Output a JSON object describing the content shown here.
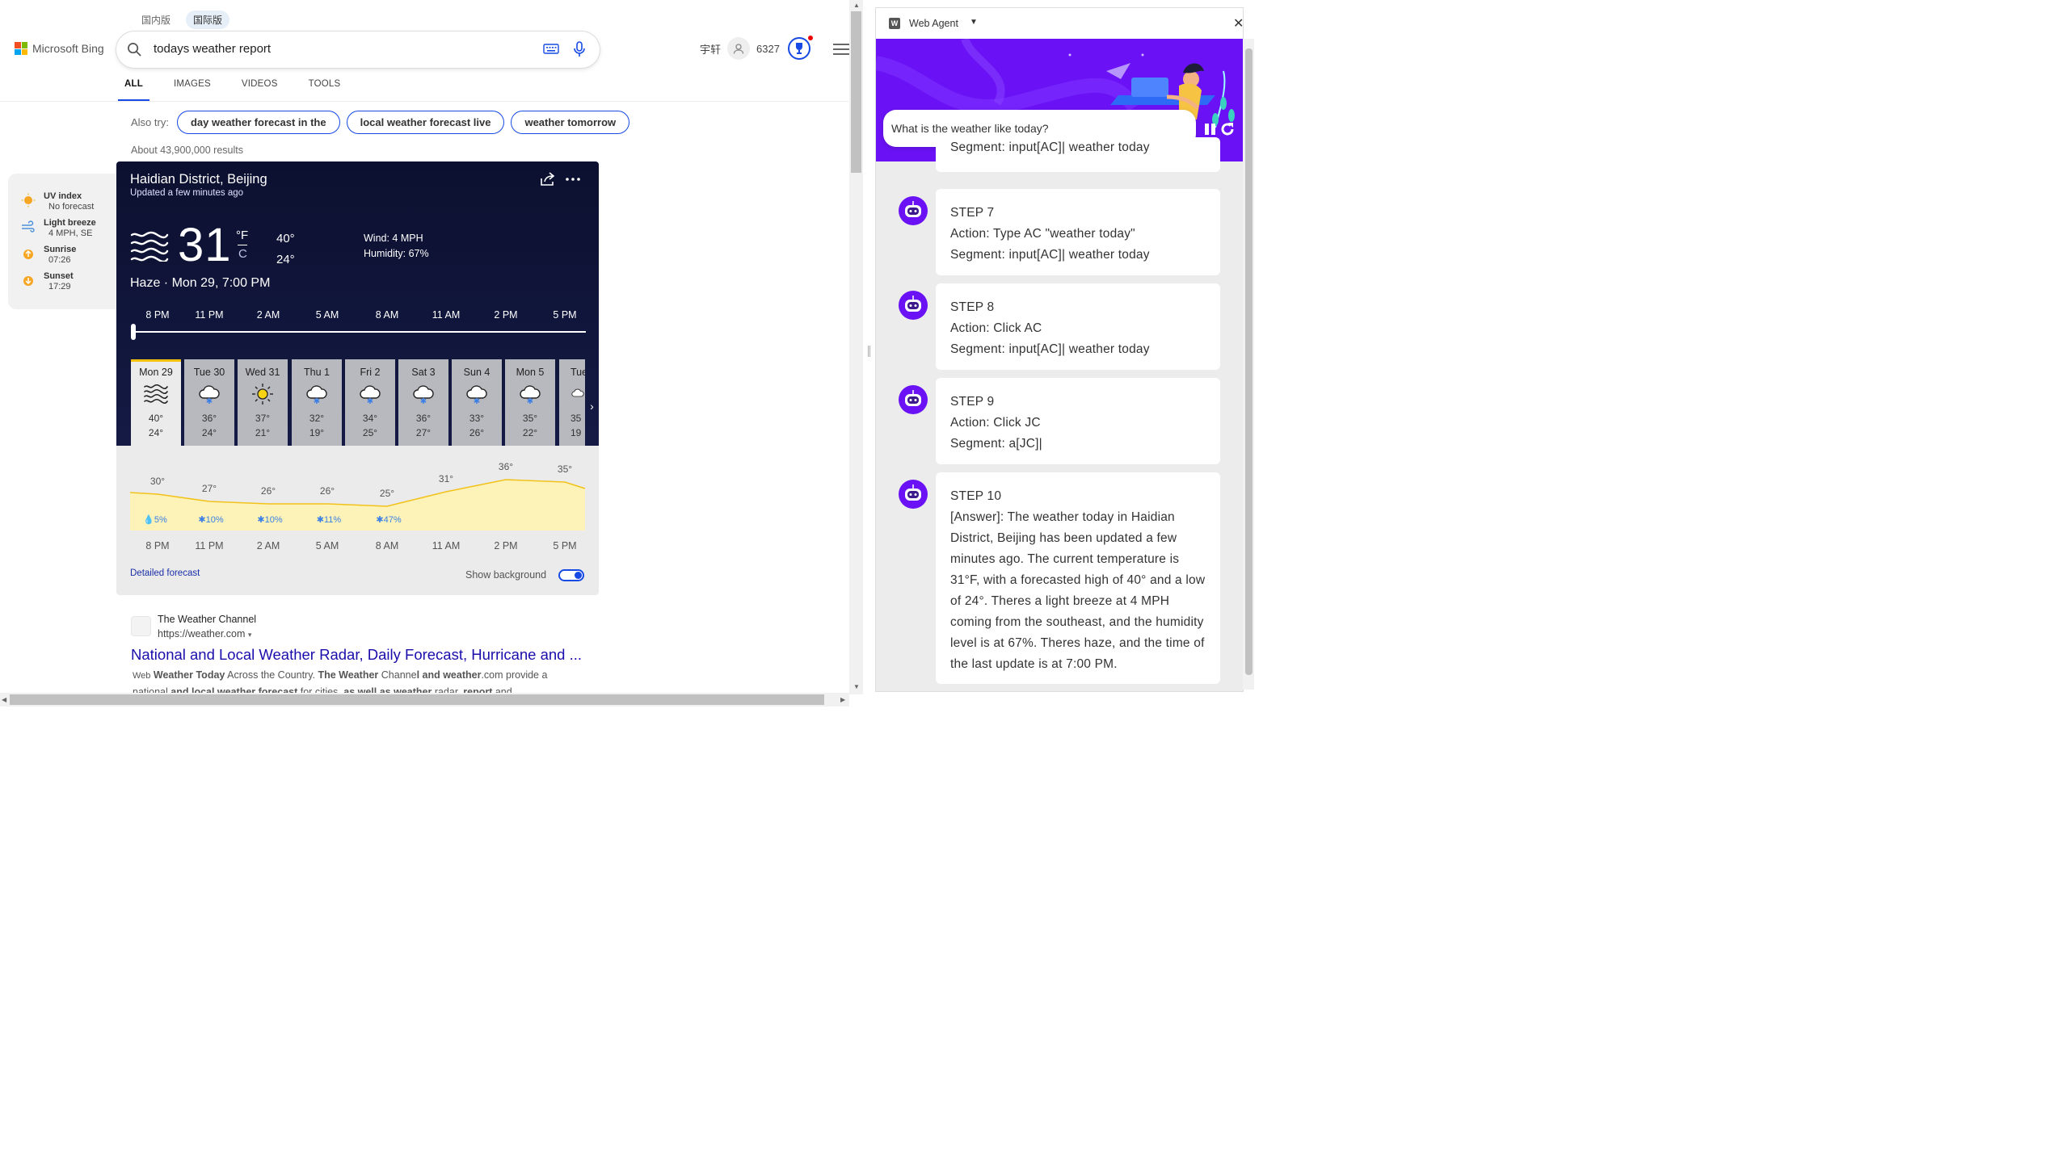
{
  "browser": {
    "markets": [
      "国内版",
      "国际版"
    ],
    "logo_text": "Microsoft Bing",
    "search_query": "todays weather report",
    "account": {
      "name": "宇轩",
      "points": "6327"
    },
    "tabs": [
      "ALL",
      "IMAGES",
      "VIDEOS",
      "TOOLS"
    ],
    "also_try_label": "Also try:",
    "also_try": [
      "day weather forecast in the",
      "local weather forecast live",
      "weather tomorrow"
    ],
    "result_count": "About 43,900,000 results"
  },
  "side_info": [
    {
      "title": "UV index",
      "value": "No forecast",
      "icon": "sun-icon"
    },
    {
      "title": "Light breeze",
      "value": "4 MPH, SE",
      "icon": "wind-icon"
    },
    {
      "title": "Sunrise",
      "value": "07:26",
      "icon": "sunrise-icon"
    },
    {
      "title": "Sunset",
      "value": "17:29",
      "icon": "sunset-icon"
    }
  ],
  "weather": {
    "location": "Haidian District, Beijing",
    "updated": "Updated a few minutes ago",
    "temp": "31",
    "unit_f": "°F",
    "unit_c": "C",
    "high": "40°",
    "low": "24°",
    "wind": "Wind: 4 MPH",
    "humidity": "Humidity: 67%",
    "condition": "Haze · Mon 29, 7:00 PM",
    "hours": [
      "8 PM",
      "11 PM",
      "2 AM",
      "5 AM",
      "8 AM",
      "11 AM",
      "2 PM",
      "5 PM"
    ],
    "days": [
      {
        "name": "Mon 29",
        "hi": "40°",
        "lo": "24°",
        "icon": "haze-icon"
      },
      {
        "name": "Tue 30",
        "hi": "36°",
        "lo": "24°",
        "icon": "snow-cloud-icon"
      },
      {
        "name": "Wed 31",
        "hi": "37°",
        "lo": "21°",
        "icon": "sun-icon"
      },
      {
        "name": "Thu 1",
        "hi": "32°",
        "lo": "19°",
        "icon": "snow-cloud-icon"
      },
      {
        "name": "Fri 2",
        "hi": "34°",
        "lo": "25°",
        "icon": "snow-cloud-icon"
      },
      {
        "name": "Sat 3",
        "hi": "36°",
        "lo": "27°",
        "icon": "snow-cloud-icon"
      },
      {
        "name": "Sun 4",
        "hi": "33°",
        "lo": "26°",
        "icon": "snow-cloud-icon"
      },
      {
        "name": "Mon 5",
        "hi": "35°",
        "lo": "22°",
        "icon": "snow-cloud-icon"
      },
      {
        "name": "Tue",
        "hi": "35",
        "lo": "19",
        "icon": "snow-cloud-icon"
      }
    ],
    "graph_temps": [
      "30°",
      "27°",
      "26°",
      "26°",
      "25°",
      "31°",
      "36°",
      "35°"
    ],
    "graph_temp_values": [
      30,
      27,
      26,
      26,
      25,
      31,
      36,
      35
    ],
    "precip": [
      "5%",
      "10%",
      "10%",
      "11%",
      "47%"
    ],
    "detailed_link": "Detailed forecast",
    "show_background": "Show background"
  },
  "result1": {
    "site": "The Weather Channel",
    "url": "https://weather.com",
    "title": "National and Local Weather Radar, Daily Forecast, Hurricane and ...",
    "snippet_prefix": "Web",
    "snippet_bold1": "Weather Today",
    "snippet_text1": "Across the Country.",
    "snippet_bold2": "The Weather",
    "snippet_text2": "Channe",
    "snippet_bold3": "l and weather",
    "snippet_text3": ".com provide a national",
    "snippet_bold4": " and local weather forecast",
    "snippet_text4": " for cities,",
    "snippet_bold5": " as well as weather",
    "snippet_text5": " radar,",
    "snippet_bold6": " report",
    "snippet_text6": " and"
  },
  "agent": {
    "title": "Web Agent",
    "query": "What is the weather like today?",
    "partial_segment": "Segment: input[AC]| weather today",
    "steps": [
      {
        "head": "STEP 7",
        "l1": "Action: Type AC \"weather today\"",
        "l2": "Segment: input[AC]| weather today"
      },
      {
        "head": "STEP 8",
        "l1": "Action: Click AC",
        "l2": "Segment: input[AC]| weather today"
      },
      {
        "head": "STEP 9",
        "l1": "Action: Click JC",
        "l2": "Segment: a[JC]|"
      },
      {
        "head": "STEP 10",
        "l1": "[Answer]: The weather today in Haidian District, Beijing has been updated a few minutes ago. The current temperature is 31°F, with a forecasted high of 40° and a low of 24°. Theres a light breeze at 4 MPH coming from the southeast, and the humidity level is at 67%. Theres haze, and the time of the last update is at 7:00 PM.",
        "l2": ""
      }
    ]
  },
  "colors": {
    "accent": "#174ae4",
    "agent_purple": "#6a12f5",
    "link": "#1a0dab",
    "graph_fill": "#fdf3b8",
    "graph_line": "#f2c21b"
  }
}
